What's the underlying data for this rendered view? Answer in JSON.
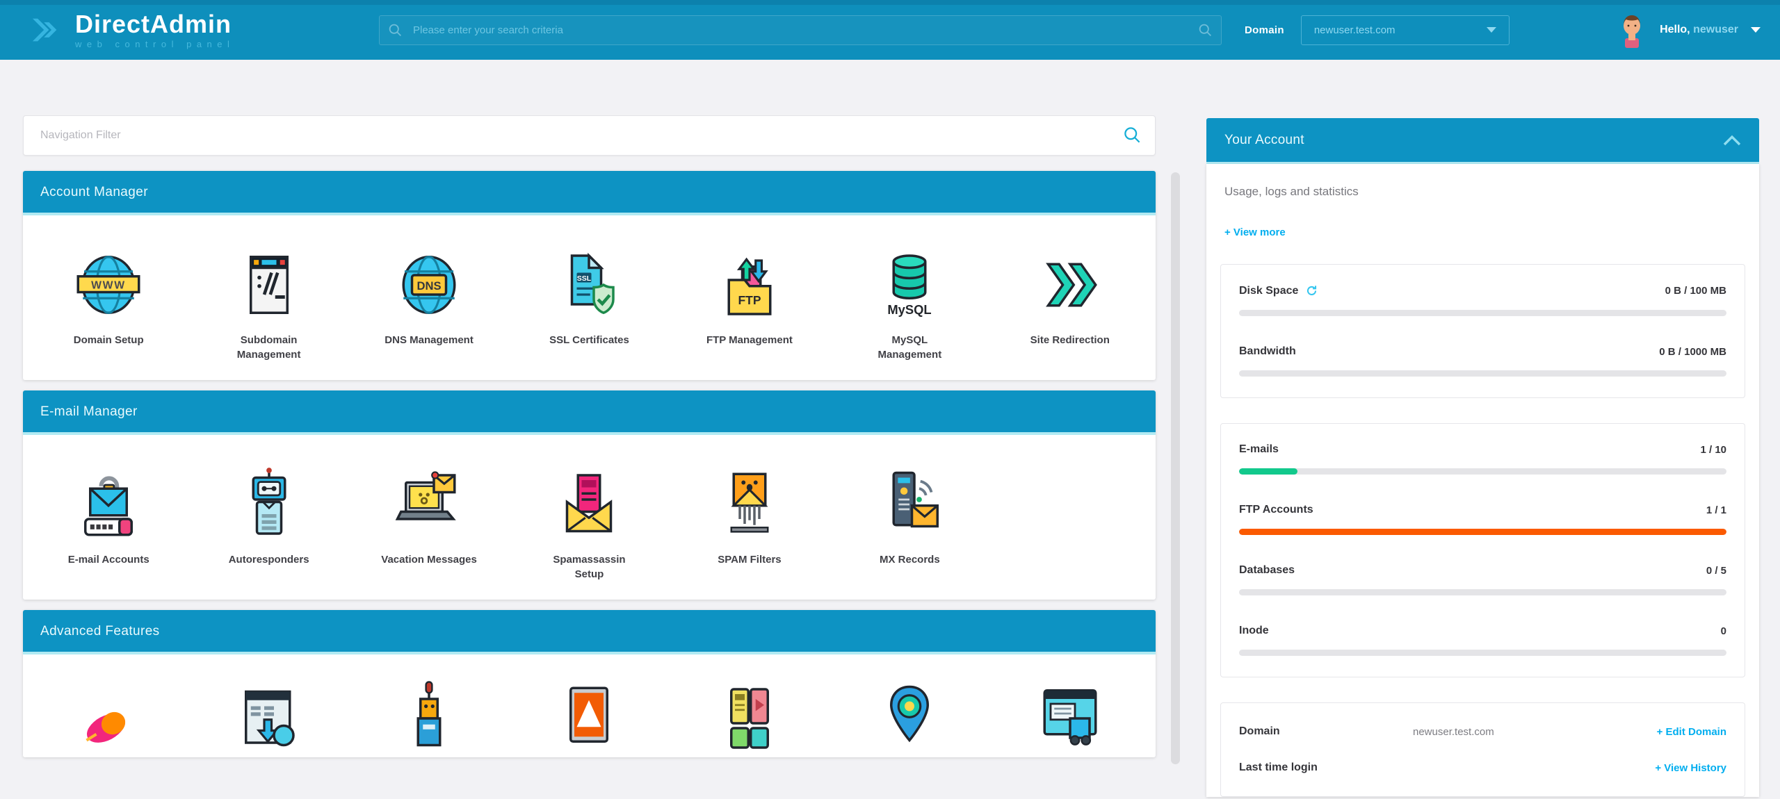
{
  "header": {
    "logo_title": "DirectAdmin",
    "logo_subtitle": "web control panel",
    "search_placeholder": "Please enter your search criteria",
    "domain_label": "Domain",
    "domain_value": "newuser.test.com",
    "greeting_prefix": "Hello,",
    "greeting_user": "newuser"
  },
  "nav_filter": {
    "placeholder": "Navigation Filter"
  },
  "sections": [
    {
      "title": "Account Manager",
      "items": [
        {
          "label": "Domain Setup",
          "icon": "globe-www-icon"
        },
        {
          "label": "Subdomain Management",
          "icon": "browser-url-icon"
        },
        {
          "label": "DNS Management",
          "icon": "globe-dns-icon"
        },
        {
          "label": "SSL Certificates",
          "icon": "certificate-shield-icon"
        },
        {
          "label": "FTP Management",
          "icon": "ftp-folder-icon"
        },
        {
          "label": "MySQL Management",
          "icon": "mysql-database-icon"
        },
        {
          "label": "Site Redirection",
          "icon": "double-chevron-icon"
        }
      ]
    },
    {
      "title": "E-mail Manager",
      "items": [
        {
          "label": "E-mail Accounts",
          "icon": "envelope-lock-icon"
        },
        {
          "label": "Autoresponders",
          "icon": "robot-icon"
        },
        {
          "label": "Vacation Messages",
          "icon": "laptop-mail-icon"
        },
        {
          "label": "Spamassassin Setup",
          "icon": "spam-letter-icon"
        },
        {
          "label": "SPAM Filters",
          "icon": "mail-shredder-icon"
        },
        {
          "label": "MX Records",
          "icon": "server-mail-icon"
        }
      ]
    },
    {
      "title": "Advanced Features",
      "items": [
        {
          "label": "",
          "icon": "comet-icon"
        },
        {
          "label": "",
          "icon": "browser-download-icon"
        },
        {
          "label": "",
          "icon": "antenna-tower-icon"
        },
        {
          "label": "",
          "icon": "warning-sign-icon"
        },
        {
          "label": "",
          "icon": "file-cards-icon"
        },
        {
          "label": "",
          "icon": "location-pin-icon"
        },
        {
          "label": "",
          "icon": "site-builder-icon"
        }
      ]
    }
  ],
  "account_panel": {
    "title": "Your Account",
    "subtitle": "Usage, logs and statistics",
    "view_more": "+ View more",
    "usage_stats": [
      {
        "label": "Disk Space",
        "value": "0 B / 100 MB",
        "pct": 0,
        "color": "#e4e4e7"
      },
      {
        "label": "Bandwidth",
        "value": "0 B / 1000 MB",
        "pct": 0,
        "color": "#e4e4e7"
      }
    ],
    "quota_stats": [
      {
        "label": "E-mails",
        "value": "1 / 10",
        "pct": 12,
        "color": "#12c98c"
      },
      {
        "label": "FTP Accounts",
        "value": "1 / 1",
        "pct": 100,
        "color": "#fb5a01"
      },
      {
        "label": "Databases",
        "value": "0 / 5",
        "pct": 0,
        "color": "#e4e4e7"
      },
      {
        "label": "Inode",
        "value": "0",
        "pct": 0,
        "color": "#e4e4e7"
      }
    ],
    "info_rows": [
      {
        "label": "Domain",
        "value": "newuser.test.com",
        "link": "+ Edit Domain"
      },
      {
        "label": "Last time login",
        "value": "",
        "link": "+ View History"
      }
    ]
  },
  "colors": {
    "header_teal": "#0e8fbc",
    "section_teal": "#0d93c3",
    "link_blue": "#00aeef",
    "bar_green": "#12c98c",
    "bar_orange": "#fb5a01"
  }
}
